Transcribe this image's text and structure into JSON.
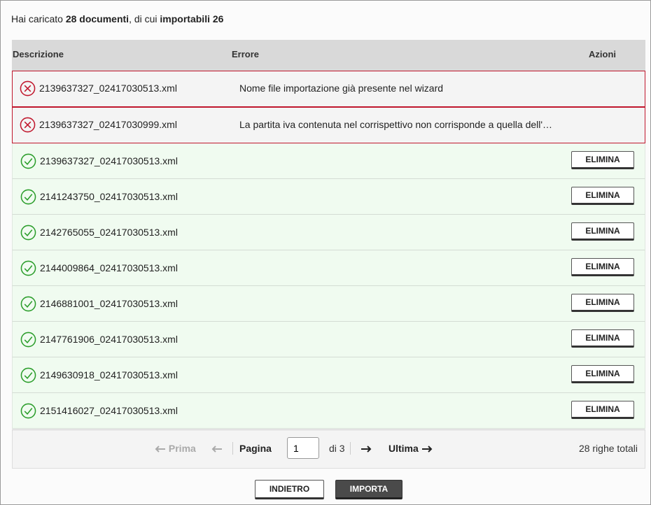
{
  "summary": {
    "prefix": "Hai caricato ",
    "docs": "28 documenti",
    "middle": ", di cui ",
    "importable": "importabili 26"
  },
  "table": {
    "headers": {
      "description": "Descrizione",
      "error": "Errore",
      "actions": "Azioni"
    },
    "rows": [
      {
        "status": "error",
        "file": "2139637327_02417030513.xml",
        "error": "Nome file importazione già presente nel wizard"
      },
      {
        "status": "error",
        "file": "2139637327_02417030999.xml",
        "error": "La partita iva contenuta nel corrispettivo non corrisponde a quella dell'…"
      },
      {
        "status": "ok",
        "file": "2139637327_02417030513.xml",
        "action": "ELIMINA"
      },
      {
        "status": "ok",
        "file": "2141243750_02417030513.xml",
        "action": "ELIMINA"
      },
      {
        "status": "ok",
        "file": "2142765055_02417030513.xml",
        "action": "ELIMINA"
      },
      {
        "status": "ok",
        "file": "2144009864_02417030513.xml",
        "action": "ELIMINA"
      },
      {
        "status": "ok",
        "file": "2146881001_02417030513.xml",
        "action": "ELIMINA"
      },
      {
        "status": "ok",
        "file": "2147761906_02417030513.xml",
        "action": "ELIMINA"
      },
      {
        "status": "ok",
        "file": "2149630918_02417030513.xml",
        "action": "ELIMINA"
      },
      {
        "status": "ok",
        "file": "2151416027_02417030513.xml",
        "action": "ELIMINA"
      }
    ]
  },
  "pager": {
    "first": "Prima",
    "page_label": "Pagina",
    "page_value": "1",
    "of": "di 3",
    "last": "Ultima",
    "total": "28 righe totali"
  },
  "buttons": {
    "back": "INDIETRO",
    "import": "IMPORTA"
  },
  "icons": {
    "error": "x-circle-icon",
    "ok": "check-circle-icon",
    "prev": "arrow-left-icon",
    "next": "arrow-right-icon"
  },
  "colors": {
    "error": "#c0162c",
    "ok": "#2a9d2a",
    "ok_row_bg": "#f0fbf0",
    "header_bg": "#d9d9d9"
  }
}
